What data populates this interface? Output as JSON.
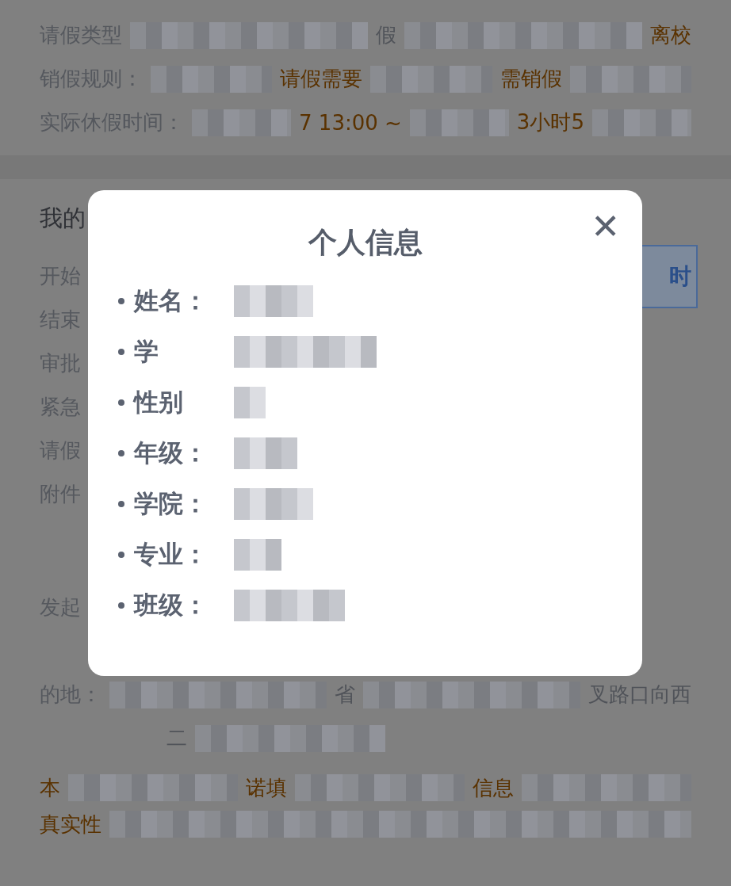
{
  "page": {
    "top_rows": [
      {
        "label": "请假类型",
        "parts": [
          {
            "kind": "redacted"
          },
          {
            "kind": "plain",
            "text": "假"
          },
          {
            "kind": "redacted"
          },
          {
            "kind": "accent",
            "text": "离校"
          }
        ]
      },
      {
        "label": "销假规则：",
        "parts": [
          {
            "kind": "redacted"
          },
          {
            "kind": "accent",
            "text": "请假需要"
          },
          {
            "kind": "redacted"
          },
          {
            "kind": "accent",
            "text": "需销假"
          },
          {
            "kind": "redacted"
          }
        ]
      },
      {
        "label": "实际休假时间：",
        "parts": [
          {
            "kind": "redacted"
          },
          {
            "kind": "accent",
            "text": "7 13:00 ~"
          },
          {
            "kind": "redacted"
          },
          {
            "kind": "accent",
            "text": "3小时5"
          },
          {
            "kind": "redacted"
          }
        ]
      }
    ],
    "section_title": "我的",
    "detail_rows": [
      {
        "label": "开始"
      },
      {
        "label": "结束"
      },
      {
        "label": "审批"
      },
      {
        "label": "紧急"
      },
      {
        "label": "请假"
      },
      {
        "label": "附件"
      }
    ],
    "side_button": {
      "label": "时"
    },
    "origin_row": {
      "label": "发起"
    },
    "address_rows": [
      {
        "label": "的地：",
        "parts": [
          {
            "kind": "redacted"
          },
          {
            "kind": "plain",
            "text": "省"
          },
          {
            "kind": "redacted"
          },
          {
            "kind": "plain",
            "text": "叉路口向西"
          }
        ]
      },
      {
        "parts": [
          {
            "kind": "plain",
            "text": "二"
          },
          {
            "kind": "redacted"
          }
        ]
      }
    ],
    "notice_rows": [
      {
        "parts": [
          {
            "kind": "accent",
            "text": "本"
          },
          {
            "kind": "redacted"
          },
          {
            "kind": "accent",
            "text": "诺填"
          },
          {
            "kind": "redacted"
          },
          {
            "kind": "accent",
            "text": "信息"
          },
          {
            "kind": "redacted"
          }
        ]
      },
      {
        "parts": [
          {
            "kind": "accent",
            "text": "真实性"
          },
          {
            "kind": "redacted"
          }
        ]
      }
    ]
  },
  "dialog": {
    "title": "个人信息",
    "close": "✕",
    "fields": [
      {
        "label": "姓名："
      },
      {
        "label": "学"
      },
      {
        "label": "性别"
      },
      {
        "label": "年级："
      },
      {
        "label": "学院："
      },
      {
        "label": "专业："
      },
      {
        "label": "班级："
      }
    ]
  }
}
